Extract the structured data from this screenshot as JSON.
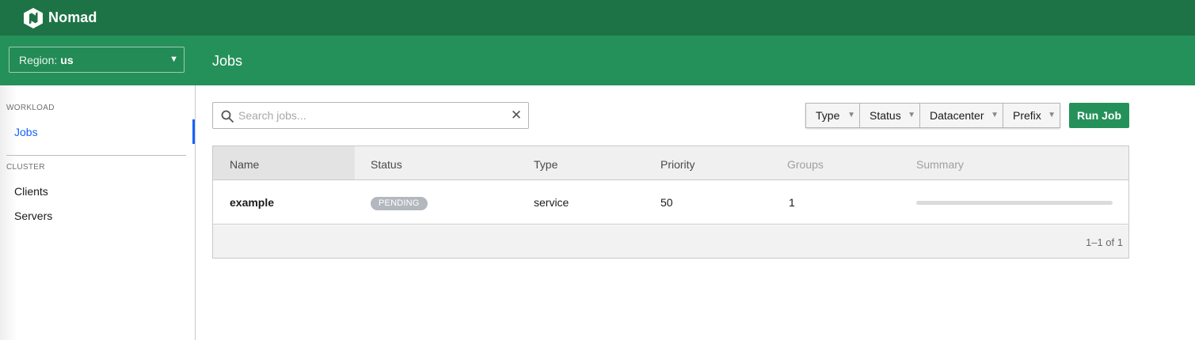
{
  "app": {
    "name": "Nomad",
    "logo_icon": "nomad-logo-icon",
    "navbar_color": "#1d7346",
    "subnav_color": "#25915a"
  },
  "region": {
    "label": "Region:",
    "value": "us"
  },
  "page": {
    "title": "Jobs"
  },
  "sidebar": {
    "sections": [
      {
        "label": "WORKLOAD",
        "items": [
          {
            "label": "Jobs",
            "active": true
          }
        ]
      },
      {
        "label": "CLUSTER",
        "items": [
          {
            "label": "Clients",
            "active": false
          },
          {
            "label": "Servers",
            "active": false
          }
        ]
      }
    ]
  },
  "search": {
    "placeholder": "Search jobs...",
    "value": "",
    "icon": "search-icon",
    "clear_icon": "close-icon"
  },
  "filters": [
    {
      "label": "Type"
    },
    {
      "label": "Status"
    },
    {
      "label": "Datacenter"
    },
    {
      "label": "Prefix"
    }
  ],
  "actions": {
    "run_job_label": "Run Job",
    "accent": "#25915a"
  },
  "table": {
    "columns": [
      "Name",
      "Status",
      "Type",
      "Priority",
      "Groups",
      "Summary"
    ],
    "rows": [
      {
        "name": "example",
        "status": "PENDING",
        "type": "service",
        "priority": "50",
        "groups": "1",
        "summary_fraction": 0
      }
    ],
    "pagination": "1–1 of 1",
    "status_badge_color": "#b3b8bf",
    "active_link_color": "#1563ff"
  }
}
